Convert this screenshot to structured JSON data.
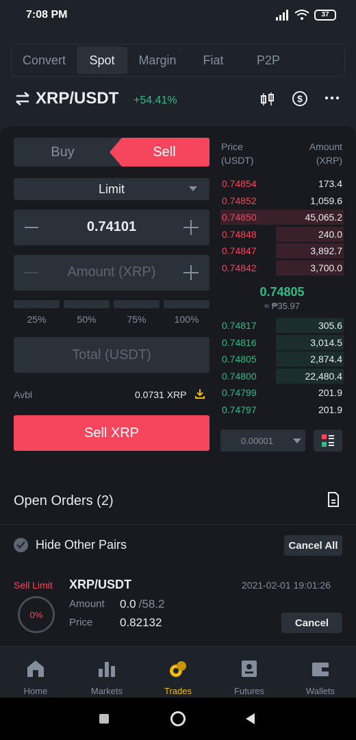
{
  "status_bar": {
    "time": "7:08 PM",
    "battery": "37"
  },
  "top_tabs": [
    {
      "label": "Convert",
      "active": false
    },
    {
      "label": "Spot",
      "active": true
    },
    {
      "label": "Margin",
      "active": false
    },
    {
      "label": "Fiat",
      "active": false
    },
    {
      "label": "P2P",
      "active": false
    }
  ],
  "pair": {
    "name": "XRP/USDT",
    "change": "+54.41%"
  },
  "trade_form": {
    "buy_label": "Buy",
    "sell_label": "Sell",
    "order_type": "Limit",
    "price_value": "0.74101",
    "amount_placeholder": "Amount (XRP)",
    "percent_labels": [
      "25%",
      "50%",
      "75%",
      "100%"
    ],
    "total_placeholder": "Total (USDT)",
    "avbl_label": "Avbl",
    "avbl_value": "0.0731 XRP",
    "submit_label": "Sell XRP"
  },
  "orderbook": {
    "price_header": "Price",
    "price_unit": "(USDT)",
    "amount_header": "Amount",
    "amount_unit": "(XRP)",
    "asks": [
      {
        "price": "0.74854",
        "amount": "173.4",
        "depth": 0.0
      },
      {
        "price": "0.74852",
        "amount": "1,059.6",
        "depth": 0.0
      },
      {
        "price": "0.74850",
        "amount": "45,065.2",
        "depth": 1.0
      },
      {
        "price": "0.74848",
        "amount": "240.0",
        "depth": 0.55
      },
      {
        "price": "0.74847",
        "amount": "3,892.7",
        "depth": 0.55
      },
      {
        "price": "0.74842",
        "amount": "3,700.0",
        "depth": 0.55
      }
    ],
    "last_price": "0.74805",
    "last_price_fiat": "≈ ₱35.97",
    "bids": [
      {
        "price": "0.74817",
        "amount": "305.6",
        "depth": 0.55
      },
      {
        "price": "0.74816",
        "amount": "3,014.5",
        "depth": 0.55
      },
      {
        "price": "0.74805",
        "amount": "2,874.4",
        "depth": 0.55
      },
      {
        "price": "0.74800",
        "amount": "22,480.4",
        "depth": 0.55
      },
      {
        "price": "0.74799",
        "amount": "201.9",
        "depth": 0.0
      },
      {
        "price": "0.74797",
        "amount": "201.9",
        "depth": 0.0
      }
    ],
    "precision": "0.00001"
  },
  "open_orders": {
    "title": "Open Orders (2)",
    "hide_other_pairs": "Hide Other Pairs",
    "cancel_all": "Cancel All",
    "order": {
      "type": "Sell Limit",
      "pair": "XRP/USDT",
      "date": "2021-02-01 19:01:26",
      "filled_pct": "0%",
      "amount_label": "Amount",
      "amount_filled": "0.0",
      "amount_total": "/58.2",
      "price_label": "Price",
      "price": "0.82132",
      "cancel_label": "Cancel"
    }
  },
  "bottom_nav": [
    {
      "label": "Home",
      "icon": "home-icon",
      "active": false
    },
    {
      "label": "Markets",
      "icon": "markets-icon",
      "active": false
    },
    {
      "label": "Trades",
      "icon": "trades-icon",
      "active": true
    },
    {
      "label": "Futures",
      "icon": "futures-icon",
      "active": false
    },
    {
      "label": "Wallets",
      "icon": "wallets-icon",
      "active": false
    }
  ],
  "colors": {
    "sell_red": "#f6465d",
    "buy_green": "#2ebd85",
    "accent_yellow": "#f0b90b",
    "background": "#181a20"
  }
}
